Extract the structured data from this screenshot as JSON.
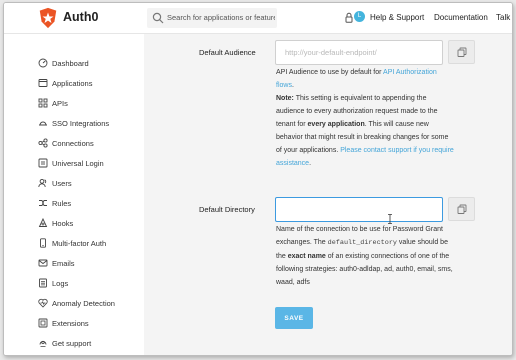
{
  "header": {
    "brand": "Auth0",
    "search_placeholder": "Search for applications or features",
    "avatar_initial": "L",
    "help_support": "Help & Support",
    "documentation": "Documentation",
    "talk": "Talk"
  },
  "sidebar": {
    "items": [
      {
        "label": "Dashboard",
        "icon": "dashboard-icon"
      },
      {
        "label": "Applications",
        "icon": "applications-icon"
      },
      {
        "label": "APIs",
        "icon": "apis-icon"
      },
      {
        "label": "SSO Integrations",
        "icon": "sso-icon"
      },
      {
        "label": "Connections",
        "icon": "connections-icon"
      },
      {
        "label": "Universal Login",
        "icon": "universal-login-icon"
      },
      {
        "label": "Users",
        "icon": "users-icon"
      },
      {
        "label": "Rules",
        "icon": "rules-icon"
      },
      {
        "label": "Hooks",
        "icon": "hooks-icon"
      },
      {
        "label": "Multi-factor Auth",
        "icon": "mfa-icon"
      },
      {
        "label": "Emails",
        "icon": "emails-icon"
      },
      {
        "label": "Logs",
        "icon": "logs-icon"
      },
      {
        "label": "Anomaly Detection",
        "icon": "anomaly-icon"
      },
      {
        "label": "Extensions",
        "icon": "extensions-icon"
      },
      {
        "label": "Get support",
        "icon": "support-icon"
      }
    ]
  },
  "audience": {
    "label": "Default Audience",
    "placeholder": "http://your-default-endpoint/",
    "value": "",
    "help1_prefix": "API Audience to use by default for ",
    "help1_link": "API Authorization flows",
    "help1_suffix": ".",
    "note_label": "Note:",
    "note_text1": " This setting is equivalent to appending the audience to every authorization request made to the tenant for ",
    "note_bold": "every application",
    "note_text2": ". This will cause new behavior that might result in breaking changes for some of your applications. ",
    "note_link": "Please contact support if you require assistance",
    "note_end": "."
  },
  "directory": {
    "label": "Default Directory",
    "value": "",
    "help_text1": "Name of the connection to be use for Password Grant exchanges. The ",
    "help_code": "default_directory",
    "help_text2": " value should be the ",
    "help_bold": "exact name",
    "help_text3": " of an existing connections of one of the following strategies: auth0-adldap, ad, auth0, email, sms, waad, adfs"
  },
  "actions": {
    "save_label": "SAVE"
  },
  "colors": {
    "accent": "#5ab6e6",
    "link": "#44a5d8",
    "brand": "#eb5424",
    "focus": "#3c9ae0"
  }
}
